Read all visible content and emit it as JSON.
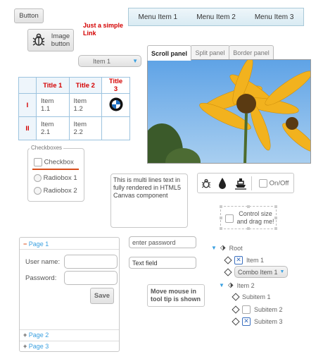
{
  "buttons": {
    "button": "Button",
    "image_button": "Image button"
  },
  "link": {
    "text": "Just a simple Link"
  },
  "menu": {
    "items": [
      "Menu Item 1",
      "Menu Item 2",
      "Menu Item 3"
    ]
  },
  "dropdown": {
    "value": "Item 1"
  },
  "tabs": [
    "Scroll panel",
    "Split panel",
    "Border panel"
  ],
  "grid": {
    "headers": [
      "Title 1",
      "Title 2",
      "Title 3"
    ],
    "rows": [
      {
        "num": "I",
        "c1": "Item 1.1",
        "c2": "Item 1.2"
      },
      {
        "num": "II",
        "c1": "Item 2.1",
        "c2": "Item 2.2"
      }
    ]
  },
  "checkboxes": {
    "title": "Checkboxes",
    "checkbox": "Checkbox",
    "radio1": "Radiobox 1",
    "radio2": "Radiobox 2"
  },
  "canvas_text": "This is multi lines text in fully rendered in HTML5 Canvas component",
  "toolbar": {
    "toggle": "On/Off"
  },
  "resize": {
    "text": "Control size and drag me!"
  },
  "login": {
    "page1": "Page 1",
    "page2": "Page 2",
    "page3": "Page 3",
    "user_label": "User name:",
    "password_label": "Password:",
    "save": "Save"
  },
  "fields": {
    "password_placeholder": "enter password",
    "text_field": "Text field"
  },
  "tooltip": "Move mouse in tool tip is shown",
  "tree": {
    "root": "Root",
    "item1": "Item 1",
    "combo": "Combo Item 1",
    "item2": "Item 2",
    "sub1": "Subitem 1",
    "sub2": "Subitem 2",
    "sub3": "Subitem 3"
  },
  "colors": {
    "accent": "#3aa0e0",
    "link": "#d40000"
  }
}
